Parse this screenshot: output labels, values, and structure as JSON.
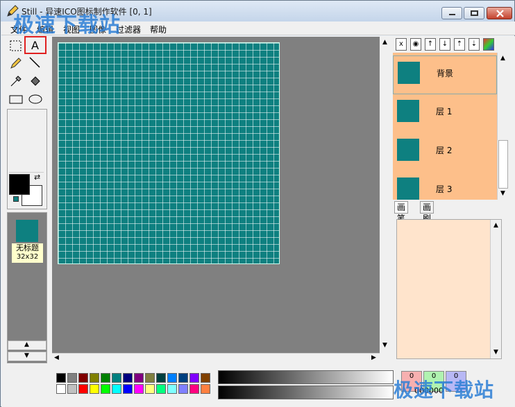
{
  "title": "Still - 异速ICO图标制作软件 [0, 1]",
  "menu": [
    "文件",
    "编辑",
    "视图",
    "图像",
    "过滤器",
    "帮助"
  ],
  "watermark": {
    "top": "极速下载站",
    "bottom": "极速下载站"
  },
  "thumbnail": {
    "name": "无标题",
    "size": "32x32"
  },
  "layers": [
    {
      "name": "背景",
      "selected": true
    },
    {
      "name": "层 1",
      "selected": false
    },
    {
      "name": "层 2",
      "selected": false
    },
    {
      "name": "层 3",
      "selected": false
    }
  ],
  "tabs": [
    "画笔",
    "画刷"
  ],
  "rgb_values": [
    "0",
    "0",
    "0"
  ],
  "hex_value": "000000",
  "colors": {
    "canvas": "#0e8080",
    "layers_bg": "#fdbf8a",
    "brush_bg": "#ffe4cc",
    "foreground": "#000000",
    "background": "#ffffff"
  },
  "palette_top": [
    "#000000",
    "#808080",
    "#800000",
    "#808000",
    "#008000",
    "#008080",
    "#000080",
    "#800080",
    "#808040",
    "#004040",
    "#0080ff",
    "#004080",
    "#8000ff",
    "#804000"
  ],
  "palette_bottom": [
    "#ffffff",
    "#c0c0c0",
    "#ff0000",
    "#ffff00",
    "#00ff00",
    "#00ffff",
    "#0000ff",
    "#ff00ff",
    "#ffff80",
    "#00ff80",
    "#80ffff",
    "#8080ff",
    "#ff0080",
    "#ff8040"
  ]
}
